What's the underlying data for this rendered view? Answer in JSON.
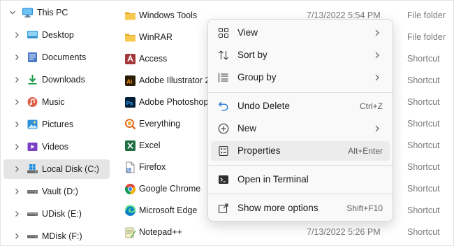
{
  "sidebar": {
    "items": [
      {
        "label": "This PC",
        "icon": "monitor-icon"
      },
      {
        "label": "Desktop",
        "icon": "desktop-icon"
      },
      {
        "label": "Documents",
        "icon": "documents-icon"
      },
      {
        "label": "Downloads",
        "icon": "download-icon"
      },
      {
        "label": "Music",
        "icon": "music-icon"
      },
      {
        "label": "Pictures",
        "icon": "pictures-icon"
      },
      {
        "label": "Videos",
        "icon": "videos-icon"
      },
      {
        "label": "Local Disk (C:)",
        "icon": "windows-drive-icon",
        "selected": true
      },
      {
        "label": "Vault (D:)",
        "icon": "drive-icon"
      },
      {
        "label": "UDisk (E:)",
        "icon": "drive-icon"
      },
      {
        "label": "MDisk (F:)",
        "icon": "drive-icon"
      }
    ]
  },
  "files": [
    {
      "name": "Windows Tools",
      "date": "7/13/2022 5:54 PM",
      "type": "File folder",
      "icon": "folder-icon"
    },
    {
      "name": "WinRAR",
      "date": "",
      "type": "File folder",
      "icon": "folder-icon"
    },
    {
      "name": "Access",
      "date": "",
      "type": "Shortcut",
      "icon": "access-icon"
    },
    {
      "name": "Adobe Illustrator 2",
      "date": "",
      "type": "Shortcut",
      "icon": "illustrator-icon"
    },
    {
      "name": "Adobe Photoshop",
      "date": "",
      "type": "Shortcut",
      "icon": "photoshop-icon"
    },
    {
      "name": "Everything",
      "date": "",
      "type": "Shortcut",
      "icon": "everything-icon"
    },
    {
      "name": "Excel",
      "date": "",
      "type": "Shortcut",
      "icon": "excel-icon"
    },
    {
      "name": "Firefox",
      "date": "",
      "type": "Shortcut",
      "icon": "shortcut-file-icon"
    },
    {
      "name": "Google Chrome",
      "date": "",
      "type": "Shortcut",
      "icon": "chrome-icon"
    },
    {
      "name": "Microsoft Edge",
      "date": "",
      "type": "Shortcut",
      "icon": "edge-icon"
    },
    {
      "name": "Notepad++",
      "date": "7/13/2022 5:26 PM",
      "type": "Shortcut",
      "icon": "notepadpp-icon"
    }
  ],
  "context_menu": {
    "items": [
      {
        "label": "View",
        "shortcut": "",
        "submenu": true,
        "icon": "view-grid-icon"
      },
      {
        "label": "Sort by",
        "shortcut": "",
        "submenu": true,
        "icon": "sort-icon"
      },
      {
        "label": "Group by",
        "shortcut": "",
        "submenu": true,
        "icon": "group-list-icon"
      },
      {
        "label": "Undo Delete",
        "shortcut": "Ctrl+Z",
        "submenu": false,
        "icon": "undo-icon"
      },
      {
        "label": "New",
        "shortcut": "",
        "submenu": true,
        "icon": "new-plus-icon"
      },
      {
        "label": "Properties",
        "shortcut": "Alt+Enter",
        "submenu": false,
        "icon": "properties-icon",
        "hover": true
      },
      {
        "label": "Open in Terminal",
        "shortcut": "",
        "submenu": false,
        "icon": "terminal-icon"
      },
      {
        "label": "Show more options",
        "shortcut": "Shift+F10",
        "submenu": false,
        "icon": "more-options-icon"
      }
    ]
  },
  "colors": {
    "accent": "#0067c0",
    "folder": "#f5c14b",
    "selected_bg": "#e5e5e5"
  }
}
